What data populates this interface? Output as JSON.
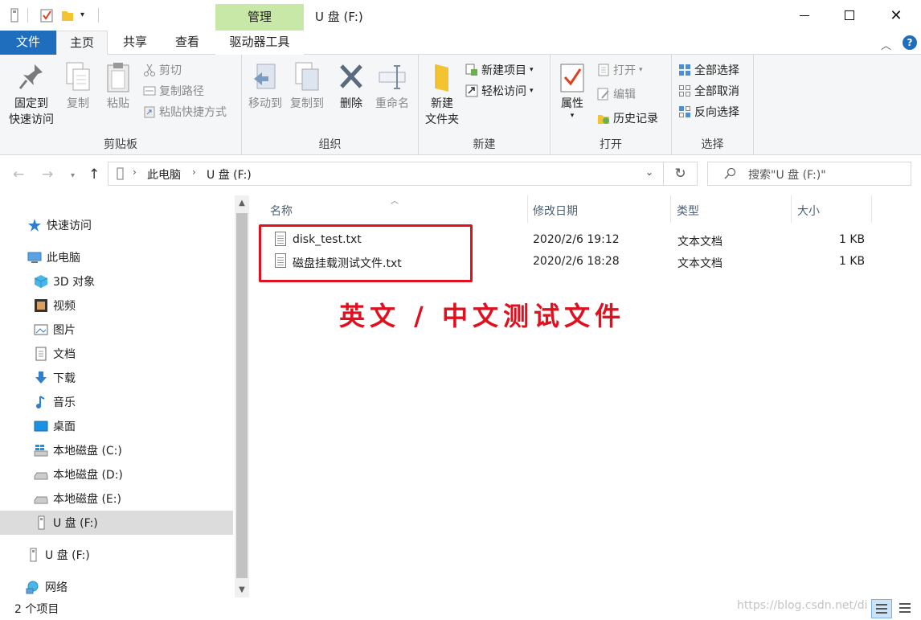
{
  "titlebar": {
    "contextual_tab": "管理",
    "title": "U 盘 (F:)"
  },
  "tabs": {
    "file": "文件",
    "home": "主页",
    "share": "共享",
    "view": "查看",
    "drive_tools": "驱动器工具"
  },
  "ribbon": {
    "clipboard": {
      "label": "剪贴板",
      "pin_line1": "固定到",
      "pin_line2": "快速访问",
      "copy": "复制",
      "paste": "粘贴",
      "cut": "剪切",
      "copy_path": "复制路径",
      "paste_shortcut": "粘贴快捷方式"
    },
    "organize": {
      "label": "组织",
      "move_to": "移动到",
      "copy_to": "复制到",
      "delete": "删除",
      "rename": "重命名"
    },
    "new": {
      "label": "新建",
      "new_folder_line1": "新建",
      "new_folder_line2": "文件夹",
      "new_item": "新建项目",
      "easy_access": "轻松访问"
    },
    "open": {
      "label": "打开",
      "properties": "属性",
      "open": "打开",
      "edit": "编辑",
      "history": "历史记录"
    },
    "select": {
      "label": "选择",
      "select_all": "全部选择",
      "select_none": "全部取消",
      "invert": "反向选择"
    }
  },
  "address": {
    "crumbs": [
      "此电脑",
      "U 盘 (F:)"
    ],
    "search_placeholder": "搜索\"U 盘 (F:)\""
  },
  "nav": {
    "quick_access": "快速访问",
    "this_pc": "此电脑",
    "items": [
      "3D 对象",
      "视频",
      "图片",
      "文档",
      "下载",
      "音乐",
      "桌面",
      "本地磁盘 (C:)",
      "本地磁盘 (D:)",
      "本地磁盘 (E:)",
      "U 盘 (F:)"
    ],
    "usb_root": "U 盘 (F:)",
    "network": "网络"
  },
  "files": {
    "columns": [
      "名称",
      "修改日期",
      "类型",
      "大小"
    ],
    "rows": [
      {
        "name": "disk_test.txt",
        "modified": "2020/2/6 19:12",
        "type": "文本文档",
        "size": "1 KB"
      },
      {
        "name": "磁盘挂载测试文件.txt",
        "modified": "2020/2/6 18:28",
        "type": "文本文档",
        "size": "1 KB"
      }
    ],
    "annotation": "英文 / 中文测试文件"
  },
  "status": {
    "count": "2 个项目",
    "watermark": "https://blog.csdn.net/di"
  },
  "colors": {
    "accent": "#1f6ebd",
    "context_tab": "#c8e8a8",
    "highlight": "#e0101e"
  }
}
